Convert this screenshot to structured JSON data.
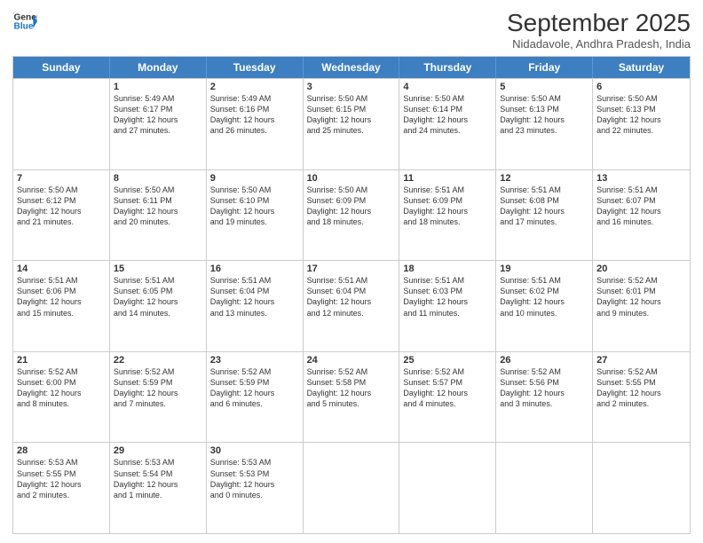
{
  "header": {
    "logo_line1": "General",
    "logo_line2": "Blue",
    "month": "September 2025",
    "location": "Nidadavole, Andhra Pradesh, India"
  },
  "days_of_week": [
    "Sunday",
    "Monday",
    "Tuesday",
    "Wednesday",
    "Thursday",
    "Friday",
    "Saturday"
  ],
  "weeks": [
    [
      {
        "day": "",
        "info": ""
      },
      {
        "day": "1",
        "info": "Sunrise: 5:49 AM\nSunset: 6:17 PM\nDaylight: 12 hours\nand 27 minutes."
      },
      {
        "day": "2",
        "info": "Sunrise: 5:49 AM\nSunset: 6:16 PM\nDaylight: 12 hours\nand 26 minutes."
      },
      {
        "day": "3",
        "info": "Sunrise: 5:50 AM\nSunset: 6:15 PM\nDaylight: 12 hours\nand 25 minutes."
      },
      {
        "day": "4",
        "info": "Sunrise: 5:50 AM\nSunset: 6:14 PM\nDaylight: 12 hours\nand 24 minutes."
      },
      {
        "day": "5",
        "info": "Sunrise: 5:50 AM\nSunset: 6:13 PM\nDaylight: 12 hours\nand 23 minutes."
      },
      {
        "day": "6",
        "info": "Sunrise: 5:50 AM\nSunset: 6:13 PM\nDaylight: 12 hours\nand 22 minutes."
      }
    ],
    [
      {
        "day": "7",
        "info": "Sunrise: 5:50 AM\nSunset: 6:12 PM\nDaylight: 12 hours\nand 21 minutes."
      },
      {
        "day": "8",
        "info": "Sunrise: 5:50 AM\nSunset: 6:11 PM\nDaylight: 12 hours\nand 20 minutes."
      },
      {
        "day": "9",
        "info": "Sunrise: 5:50 AM\nSunset: 6:10 PM\nDaylight: 12 hours\nand 19 minutes."
      },
      {
        "day": "10",
        "info": "Sunrise: 5:50 AM\nSunset: 6:09 PM\nDaylight: 12 hours\nand 18 minutes."
      },
      {
        "day": "11",
        "info": "Sunrise: 5:51 AM\nSunset: 6:09 PM\nDaylight: 12 hours\nand 18 minutes."
      },
      {
        "day": "12",
        "info": "Sunrise: 5:51 AM\nSunset: 6:08 PM\nDaylight: 12 hours\nand 17 minutes."
      },
      {
        "day": "13",
        "info": "Sunrise: 5:51 AM\nSunset: 6:07 PM\nDaylight: 12 hours\nand 16 minutes."
      }
    ],
    [
      {
        "day": "14",
        "info": "Sunrise: 5:51 AM\nSunset: 6:06 PM\nDaylight: 12 hours\nand 15 minutes."
      },
      {
        "day": "15",
        "info": "Sunrise: 5:51 AM\nSunset: 6:05 PM\nDaylight: 12 hours\nand 14 minutes."
      },
      {
        "day": "16",
        "info": "Sunrise: 5:51 AM\nSunset: 6:04 PM\nDaylight: 12 hours\nand 13 minutes."
      },
      {
        "day": "17",
        "info": "Sunrise: 5:51 AM\nSunset: 6:04 PM\nDaylight: 12 hours\nand 12 minutes."
      },
      {
        "day": "18",
        "info": "Sunrise: 5:51 AM\nSunset: 6:03 PM\nDaylight: 12 hours\nand 11 minutes."
      },
      {
        "day": "19",
        "info": "Sunrise: 5:51 AM\nSunset: 6:02 PM\nDaylight: 12 hours\nand 10 minutes."
      },
      {
        "day": "20",
        "info": "Sunrise: 5:52 AM\nSunset: 6:01 PM\nDaylight: 12 hours\nand 9 minutes."
      }
    ],
    [
      {
        "day": "21",
        "info": "Sunrise: 5:52 AM\nSunset: 6:00 PM\nDaylight: 12 hours\nand 8 minutes."
      },
      {
        "day": "22",
        "info": "Sunrise: 5:52 AM\nSunset: 5:59 PM\nDaylight: 12 hours\nand 7 minutes."
      },
      {
        "day": "23",
        "info": "Sunrise: 5:52 AM\nSunset: 5:59 PM\nDaylight: 12 hours\nand 6 minutes."
      },
      {
        "day": "24",
        "info": "Sunrise: 5:52 AM\nSunset: 5:58 PM\nDaylight: 12 hours\nand 5 minutes."
      },
      {
        "day": "25",
        "info": "Sunrise: 5:52 AM\nSunset: 5:57 PM\nDaylight: 12 hours\nand 4 minutes."
      },
      {
        "day": "26",
        "info": "Sunrise: 5:52 AM\nSunset: 5:56 PM\nDaylight: 12 hours\nand 3 minutes."
      },
      {
        "day": "27",
        "info": "Sunrise: 5:52 AM\nSunset: 5:55 PM\nDaylight: 12 hours\nand 2 minutes."
      }
    ],
    [
      {
        "day": "28",
        "info": "Sunrise: 5:53 AM\nSunset: 5:55 PM\nDaylight: 12 hours\nand 2 minutes."
      },
      {
        "day": "29",
        "info": "Sunrise: 5:53 AM\nSunset: 5:54 PM\nDaylight: 12 hours\nand 1 minute."
      },
      {
        "day": "30",
        "info": "Sunrise: 5:53 AM\nSunset: 5:53 PM\nDaylight: 12 hours\nand 0 minutes."
      },
      {
        "day": "",
        "info": ""
      },
      {
        "day": "",
        "info": ""
      },
      {
        "day": "",
        "info": ""
      },
      {
        "day": "",
        "info": ""
      }
    ]
  ]
}
